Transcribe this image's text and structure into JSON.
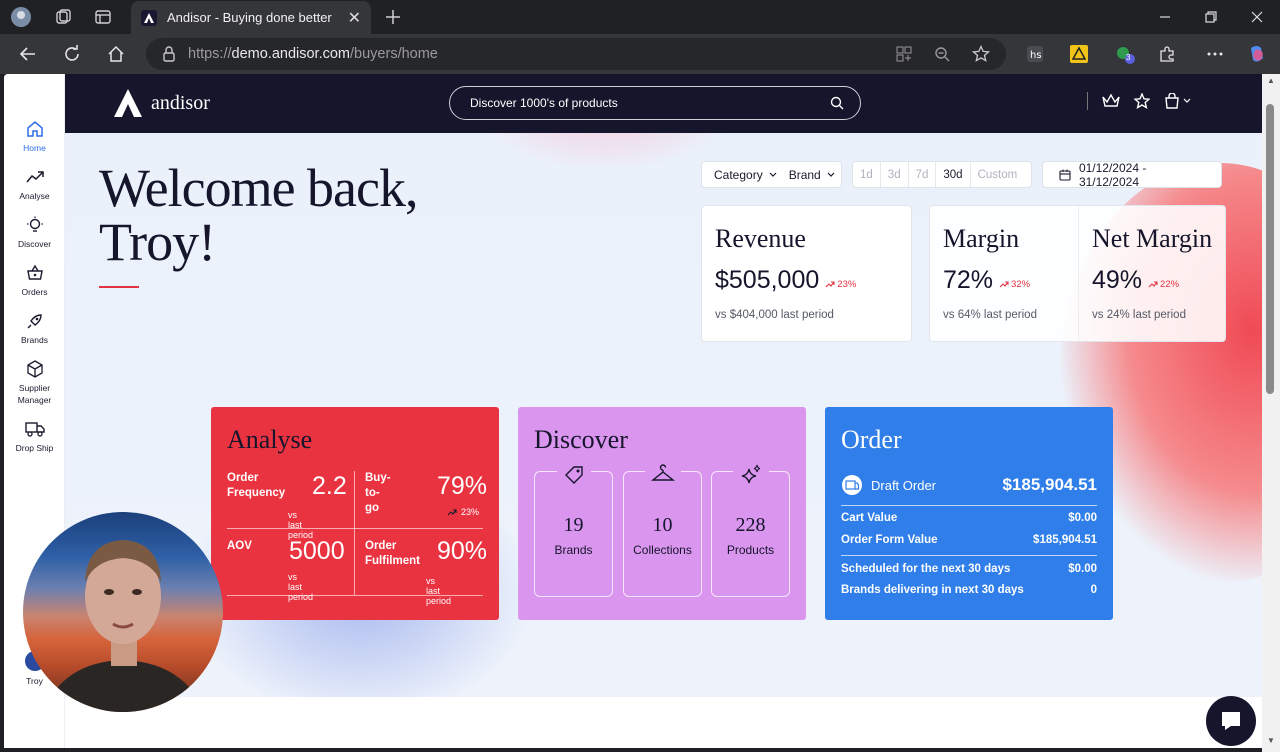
{
  "browser": {
    "tab_title": "Andisor - Buying done better",
    "url_prefix": "https://",
    "url_domain": "demo.andisor.com",
    "url_path": "/buyers/home",
    "extension_badge": "3"
  },
  "sidebar": {
    "items": [
      {
        "label": "Home",
        "icon": "home-icon"
      },
      {
        "label": "Analyse",
        "icon": "trend-icon"
      },
      {
        "label": "Discover",
        "icon": "bulb-icon"
      },
      {
        "label": "Orders",
        "icon": "basket-icon"
      },
      {
        "label": "Brands",
        "icon": "rocket-icon"
      },
      {
        "label": "Supplier Manager",
        "icon": "box-icon"
      },
      {
        "label": "Drop Ship",
        "icon": "truck-icon"
      }
    ],
    "user": "Troy"
  },
  "topnav": {
    "logo_text": "andisor",
    "search_placeholder": "Discover 1000's of products"
  },
  "hero": {
    "greeting_line1": "Welcome back,",
    "greeting_line2": "Troy!"
  },
  "filters": {
    "category": "Category",
    "brand": "Brand",
    "ranges": [
      "1d",
      "3d",
      "7d",
      "30d",
      "Custom"
    ],
    "active_range": "30d",
    "date_range": "01/12/2024 - 31/12/2024"
  },
  "kpis": {
    "revenue": {
      "title": "Revenue",
      "value": "$505,000",
      "delta": "23%",
      "sub": "vs $404,000 last period"
    },
    "margin": {
      "title": "Margin",
      "value": "72%",
      "delta": "32%",
      "sub": "vs 64% last period"
    },
    "net_margin": {
      "title": "Net Margin",
      "value": "49%",
      "delta": "22%",
      "sub": "vs 24% last period"
    }
  },
  "analyse": {
    "title": "Analyse",
    "order_frequency": {
      "label": "Order Frequency",
      "value": "2.2",
      "sub": "vs last period"
    },
    "buy_to_go": {
      "label": "Buy-to-go",
      "value": "79%",
      "delta": "23%"
    },
    "aov": {
      "label": "AOV",
      "value": "5000",
      "sub": "vs last period"
    },
    "order_fulfilment": {
      "label": "Order Fulfilment",
      "value": "90%",
      "sub": "vs last period"
    }
  },
  "discover": {
    "title": "Discover",
    "boxes": [
      {
        "count": "19",
        "label": "Brands",
        "icon": "tag-icon"
      },
      {
        "count": "10",
        "label": "Collections",
        "icon": "hanger-icon"
      },
      {
        "count": "228",
        "label": "Products",
        "icon": "sparkle-icon"
      }
    ]
  },
  "order": {
    "title": "Order",
    "draft_label": "Draft Order",
    "draft_value": "$185,904.51",
    "rows": [
      {
        "label": "Cart Value",
        "value": "$0.00"
      },
      {
        "label": "Order Form Value",
        "value": "$185,904.51"
      },
      {
        "label": "Scheduled for the next 30 days",
        "value": "$0.00"
      },
      {
        "label": "Brands delivering in next 30 days",
        "value": "0"
      }
    ]
  },
  "colors": {
    "nav_bg": "#15152b",
    "analyse_bg": "#ea3340",
    "discover_bg": "#da96ee",
    "order_bg": "#2f7ee9",
    "accent_red": "#e2323f",
    "active_blue": "#2f6fe8"
  }
}
